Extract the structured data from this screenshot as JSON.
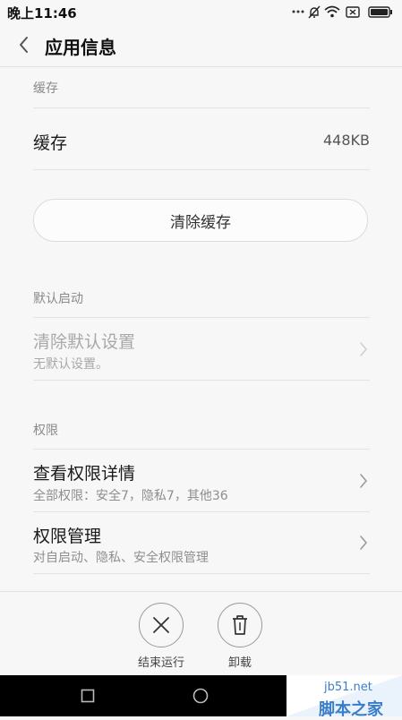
{
  "status_bar": {
    "time": "晚上11:46",
    "icons": [
      "dots-icon",
      "bell-muted-icon",
      "wifi-icon",
      "sim-none-icon",
      "battery-icon"
    ]
  },
  "header": {
    "title": "应用信息",
    "back_icon": "chevron-left-icon"
  },
  "cache": {
    "section_title": "缓存",
    "row_label": "缓存",
    "row_value": "448KB",
    "clear_button": "清除缓存"
  },
  "default_launch": {
    "section_title": "默认启动",
    "row_title": "清除默认设置",
    "row_sub": "无默认设置。"
  },
  "permissions": {
    "section_title": "权限",
    "items": [
      {
        "title": "查看权限详情",
        "sub": "全部权限：安全7，隐私7，其他36"
      },
      {
        "title": "权限管理",
        "sub": "对自启动、隐私、安全权限管理"
      }
    ]
  },
  "actions": {
    "stop_label": "结束运行",
    "uninstall_label": "卸载"
  },
  "watermark": {
    "domain": "jb51.net",
    "name": "脚本之家"
  },
  "colors": {
    "background": "#f7f7f7",
    "text_primary": "#1a1a1a",
    "text_secondary": "#8e8e8e",
    "divider": "#e3e3e3",
    "nav_bar": "#000000",
    "watermark": "#3a7dc9"
  }
}
